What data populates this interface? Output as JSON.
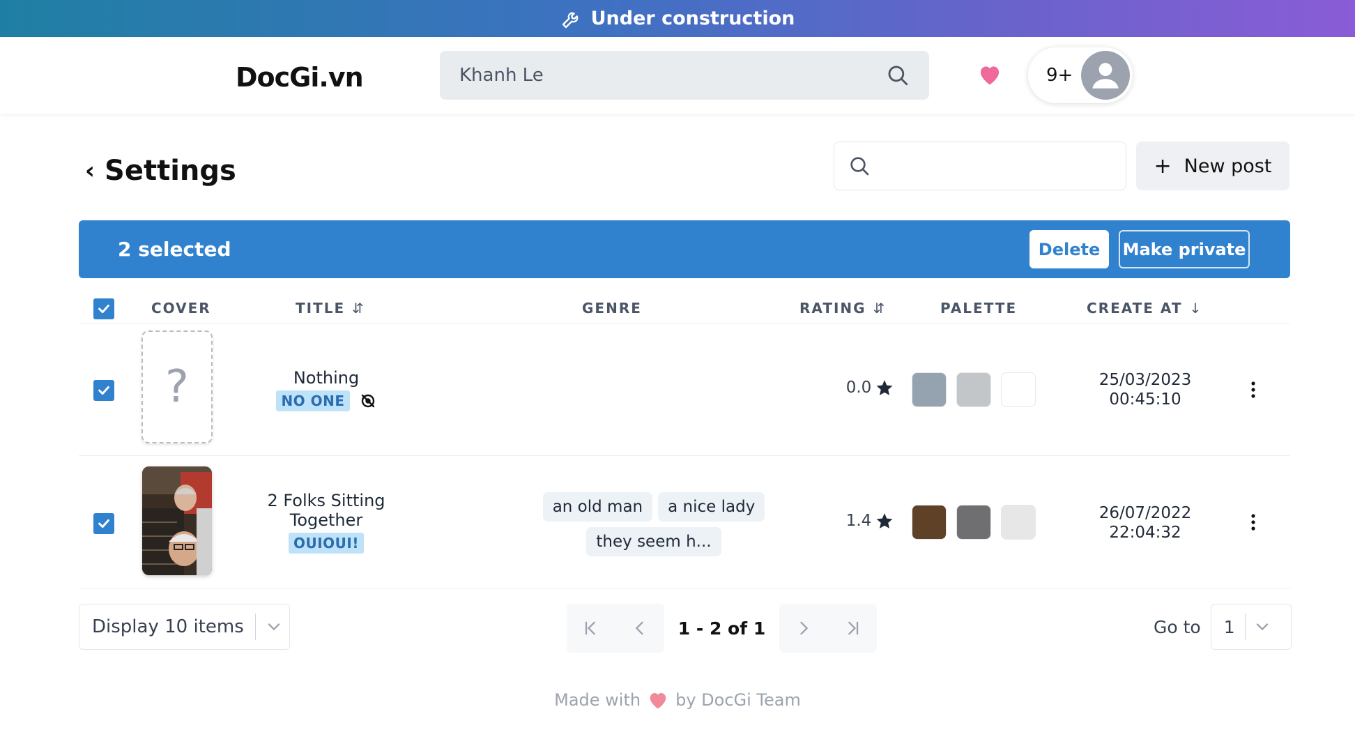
{
  "banner": {
    "text": "Under construction",
    "icon": "wrench-icon"
  },
  "header": {
    "logo": "DocGi.vn",
    "search": {
      "value": "Khanh Le",
      "icon": "search-icon"
    },
    "notification_count": "9+"
  },
  "page": {
    "title": "Settings",
    "search_placeholder": "",
    "new_post_label": "New post"
  },
  "selection_bar": {
    "label": "2 selected",
    "delete_label": "Delete",
    "make_private_label": "Make private",
    "color": "#3182ce"
  },
  "table": {
    "columns": [
      "COVER",
      "TITLE",
      "GENRE",
      "RATING",
      "PALETTE",
      "CREATE AT"
    ],
    "rows": [
      {
        "checked": true,
        "cover": "?",
        "title": "Nothing",
        "badge": "NO ONE",
        "hidden_icon": "eye-off-icon",
        "genres": [],
        "rating": "0.0",
        "palette": [
          "#95a3b0",
          "#c2c6c9",
          "#ffffff"
        ],
        "date": "25/03/2023",
        "time": "00:45:10"
      },
      {
        "checked": true,
        "cover": "photo",
        "title_line1": "2 Folks Sitting",
        "title_line2": "Together",
        "badge": "OUIOUI!",
        "genres": [
          "an old man",
          "a nice lady",
          "they seem h..."
        ],
        "rating": "1.4",
        "palette": [
          "#5e4126",
          "#6f6f72",
          "#e7e7e7"
        ],
        "date": "26/07/2022",
        "time": "22:04:32"
      }
    ]
  },
  "pagination": {
    "display_label": "Display 10 items",
    "range_label": "1 - 2 of 1",
    "goto_label": "Go to",
    "goto_value": "1"
  },
  "footer": {
    "before": "Made with",
    "after": "by DocGi Team"
  }
}
